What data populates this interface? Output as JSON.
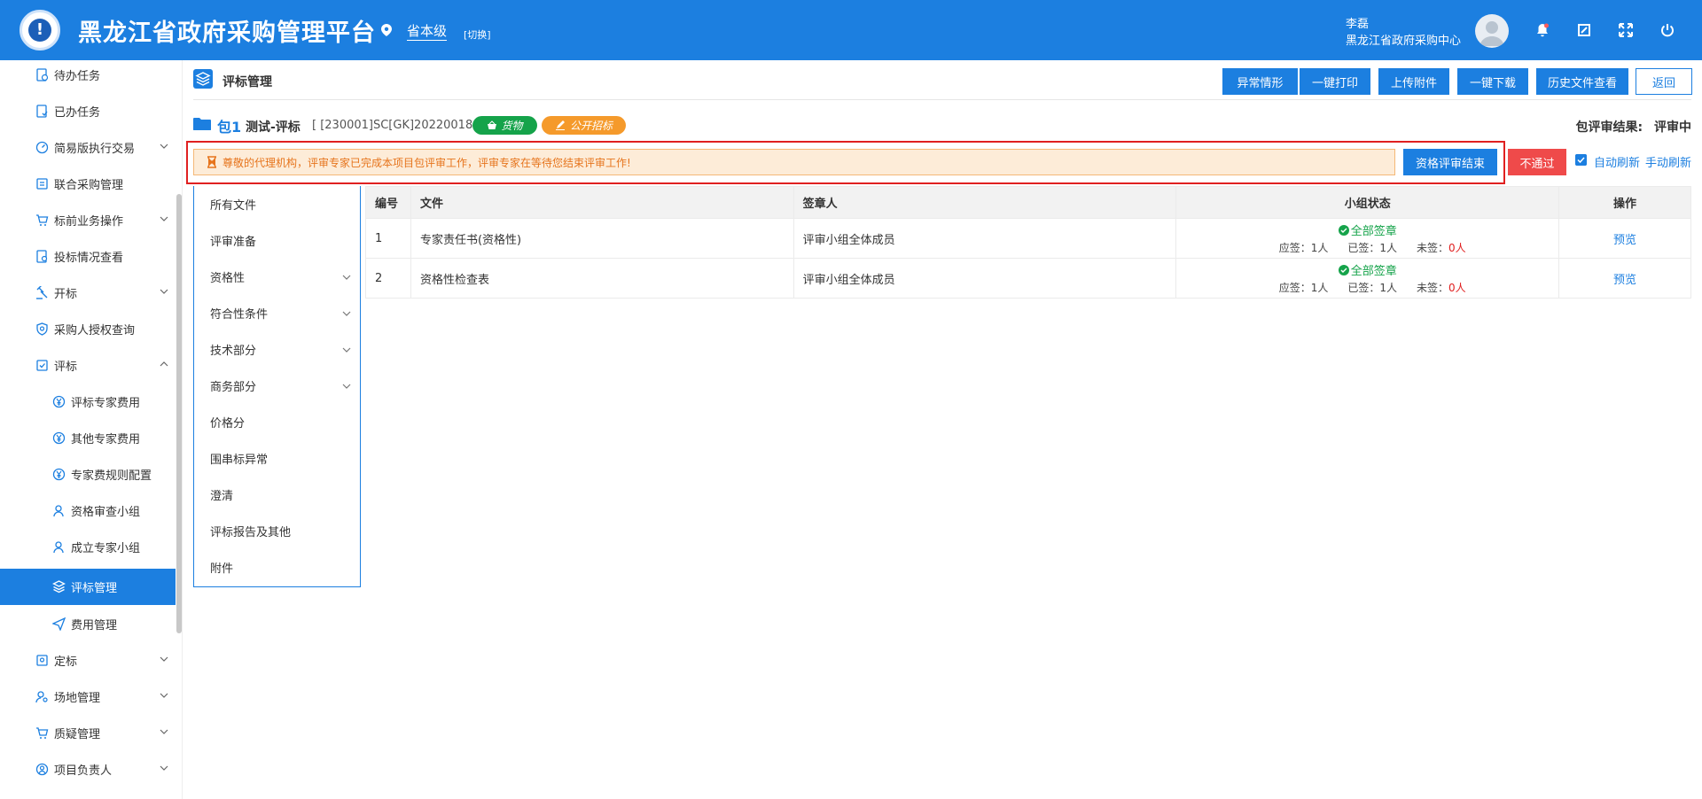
{
  "header": {
    "logo_mark": "!",
    "title": "黑龙江省政府采购管理平台",
    "level": "省本级",
    "switch_label": "[切换]",
    "user_name": "李磊",
    "user_org": "黑龙江省政府采购中心"
  },
  "sidebar": {
    "items": [
      {
        "label": "待办任务"
      },
      {
        "label": "已办任务"
      },
      {
        "label": "简易版执行交易"
      },
      {
        "label": "联合采购管理"
      },
      {
        "label": "标前业务操作"
      },
      {
        "label": "投标情况查看"
      },
      {
        "label": "开标"
      },
      {
        "label": "采购人授权查询"
      },
      {
        "label": "评标"
      },
      {
        "label": "评标专家费用"
      },
      {
        "label": "其他专家费用"
      },
      {
        "label": "专家费规则配置"
      },
      {
        "label": "资格审查小组"
      },
      {
        "label": "成立专家小组"
      },
      {
        "label": "评标管理"
      },
      {
        "label": "费用管理"
      },
      {
        "label": "定标"
      },
      {
        "label": "场地管理"
      },
      {
        "label": "质疑管理"
      },
      {
        "label": "项目负责人"
      }
    ]
  },
  "page": {
    "title": "评标管理",
    "buttons": {
      "abnormal": "异常情形",
      "print": "一键打印",
      "upload": "上传附件",
      "download": "一键下载",
      "history": "历史文件查看",
      "back": "返回"
    }
  },
  "package": {
    "num": "包1",
    "name": "测试-评标",
    "code": "[ [230001]SC[GK]20220018 ]",
    "badge_goods": "货物",
    "badge_method": "公开招标",
    "result_label": "包评审结果:",
    "result_value": "评审中"
  },
  "notice": {
    "text": "尊敬的代理机构，评审专家已完成本项目包评审工作，评审专家在等待您结束评审工作!",
    "qual_button": "资格评审结束",
    "fail_button": "不通过",
    "auto_refresh": "自动刷新",
    "manual_refresh": "手动刷新"
  },
  "filters": [
    {
      "label": "所有文件"
    },
    {
      "label": "评审准备"
    },
    {
      "label": "资格性"
    },
    {
      "label": "符合性条件"
    },
    {
      "label": "技术部分"
    },
    {
      "label": "商务部分"
    },
    {
      "label": "价格分"
    },
    {
      "label": "围串标异常"
    },
    {
      "label": "澄清"
    },
    {
      "label": "评标报告及其他"
    },
    {
      "label": "附件"
    }
  ],
  "table": {
    "headers": {
      "num": "编号",
      "file": "文件",
      "signer": "签章人",
      "status": "小组状态",
      "op": "操作"
    },
    "rows": [
      {
        "num": "1",
        "file": "专家责任书(资格性)",
        "signer": "评审小组全体成员",
        "status": "全部签章",
        "should": "应签：1人",
        "signed": "已签：1人",
        "unsigned_label": "未签：",
        "unsigned_value": "0人",
        "op": "预览"
      },
      {
        "num": "2",
        "file": "资格性检查表",
        "signer": "评审小组全体成员",
        "status": "全部签章",
        "should": "应签：1人",
        "signed": "已签：1人",
        "unsigned_label": "未签：",
        "unsigned_value": "0人",
        "op": "预览"
      }
    ]
  }
}
